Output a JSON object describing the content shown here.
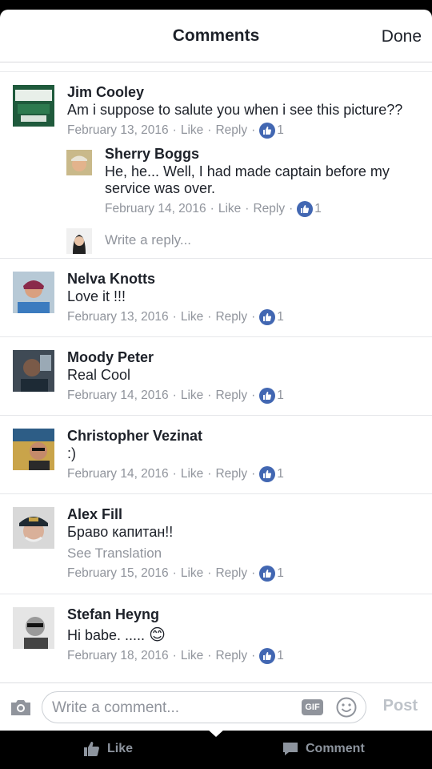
{
  "header": {
    "title": "Comments",
    "done_label": "Done"
  },
  "comments": [
    {
      "name": "Jim Cooley",
      "text": "Am i suppose to salute you when i see this picture??",
      "date": "February 13, 2016",
      "like_label": "Like",
      "reply_label": "Reply",
      "likes": "1",
      "reply": {
        "name": "Sherry Boggs",
        "text": "He, he... Well, I had made captain before my service was over.",
        "date": "February 14, 2016",
        "like_label": "Like",
        "reply_label": "Reply",
        "likes": "1"
      },
      "reply_placeholder": "Write a reply..."
    },
    {
      "name": "Nelva Knotts",
      "text": "Love it !!!",
      "date": "February 13, 2016",
      "like_label": "Like",
      "reply_label": "Reply",
      "likes": "1"
    },
    {
      "name": "Moody Peter",
      "text": "Real Cool",
      "date": "February 14, 2016",
      "like_label": "Like",
      "reply_label": "Reply",
      "likes": "1"
    },
    {
      "name": "Christopher Vezinat",
      "text": ":)",
      "date": "February 14, 2016",
      "like_label": "Like",
      "reply_label": "Reply",
      "likes": "1"
    },
    {
      "name": "Alex Fill",
      "text": "Браво капитан!!",
      "translation_label": "See Translation",
      "date": "February 15, 2016",
      "like_label": "Like",
      "reply_label": "Reply",
      "likes": "1"
    },
    {
      "name": "Stefan Heyng",
      "text": "Hi babe. .....",
      "emoji": "😊",
      "date": "February 18, 2016",
      "like_label": "Like",
      "reply_label": "Reply",
      "likes": "1"
    }
  ],
  "composer": {
    "placeholder": "Write a comment...",
    "gif_label": "GIF",
    "post_label": "Post"
  },
  "bottom_bar": {
    "like_label": "Like",
    "comment_label": "Comment"
  },
  "colors": {
    "accent": "#4267b2",
    "meta": "#90949c",
    "text": "#1d2129"
  }
}
